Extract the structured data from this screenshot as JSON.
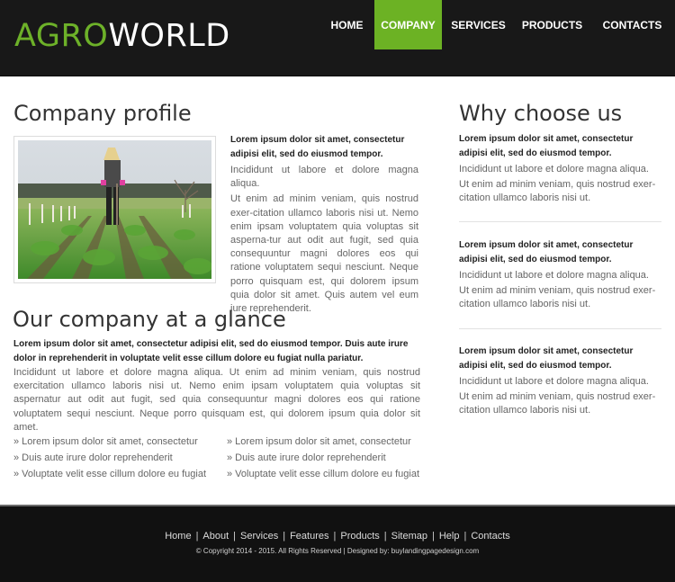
{
  "header": {
    "logo": {
      "part1": "AGRO",
      "part2": "WORLD"
    },
    "nav": [
      {
        "label": "HOME",
        "active": false
      },
      {
        "label": "COMPANY",
        "active": true
      },
      {
        "label": "SERVICES",
        "active": false
      },
      {
        "label": "PRODUCTS",
        "active": false
      },
      {
        "label": "CONTACTS",
        "active": false
      }
    ]
  },
  "colors": {
    "accent": "#6cb224",
    "header_bg": "#181818",
    "footer_bg": "#111111"
  },
  "profile": {
    "title": "Company profile",
    "image_alt": "Farmer with straw hat hoeing a field of green crops",
    "lead": "Lorem ipsum dolor sit amet, consectetur adipisi elit, sed do eiusmod tempor.",
    "p1": "Incididunt ut labore et dolore magna aliqua.",
    "p2": "Ut enim ad minim veniam, quis nostrud exer-citation ullamco laboris nisi ut. Nemo enim ipsam voluptatem quia voluptas sit asperna-tur aut odit aut fugit, sed quia consequuntur magni dolores eos qui ratione voluptatem sequi nesciunt. Neque porro quisquam est, qui dolorem ipsum quia dolor sit amet. Quis autem vel eum iure reprehenderit."
  },
  "glance": {
    "title": "Our company at a glance",
    "lead": "Lorem ipsum dolor sit amet, consectetur adipisi elit, sed do eiusmod tempor. Duis aute irure dolor in reprehenderit in voluptate velit esse cillum dolore eu fugiat nulla pariatur.",
    "text": "Incididunt ut labore et dolore magna aliqua. Ut enim ad minim veniam, quis nostrud exercitation ullamco laboris nisi ut. Nemo enim ipsam voluptatem quia voluptas sit aspernatur aut odit aut fugit, sed quia consequuntur magni dolores eos qui ratione voluptatem sequi nesciunt. Neque porro quisquam est, qui dolorem ipsum quia dolor sit amet.",
    "list_col1": [
      "» Lorem ipsum dolor sit amet, consectetur",
      "» Duis aute irure dolor reprehenderit",
      "» Voluptate velit esse cillum dolore eu fugiat"
    ],
    "list_col2": [
      "» Lorem ipsum dolor sit amet, consectetur",
      "» Duis aute irure dolor reprehenderit",
      "» Voluptate velit esse cillum dolore eu fugiat"
    ]
  },
  "why": {
    "title": "Why choose us",
    "blocks": [
      {
        "lead": "Lorem ipsum dolor sit amet, consectetur adipisi elit, sed do eiusmod tempor.",
        "p1": "Incididunt ut labore et dolore magna aliqua.",
        "p2": "Ut enim ad minim veniam, quis nostrud exer-citation ullamco laboris nisi ut."
      },
      {
        "lead": "Lorem ipsum dolor sit amet, consectetur adipisi elit, sed do eiusmod tempor.",
        "p1": "Incididunt ut labore et dolore magna aliqua.",
        "p2": "Ut enim ad minim veniam, quis nostrud exer-citation ullamco laboris nisi ut."
      },
      {
        "lead": "Lorem ipsum dolor sit amet, consectetur adipisi elit, sed do eiusmod tempor.",
        "p1": "Incididunt ut labore et dolore magna aliqua.",
        "p2": "Ut enim ad minim veniam, quis nostrud exer-citation ullamco laboris nisi ut."
      }
    ]
  },
  "footer": {
    "links": [
      "Home",
      "About",
      "Services",
      "Features",
      "Products",
      "Sitemap",
      "Help",
      "Contacts"
    ],
    "separator": "|",
    "copyright": "© Copyright 2014 - 2015. All Rights Reserved | Designed by: buylandingpagedesign.com"
  }
}
